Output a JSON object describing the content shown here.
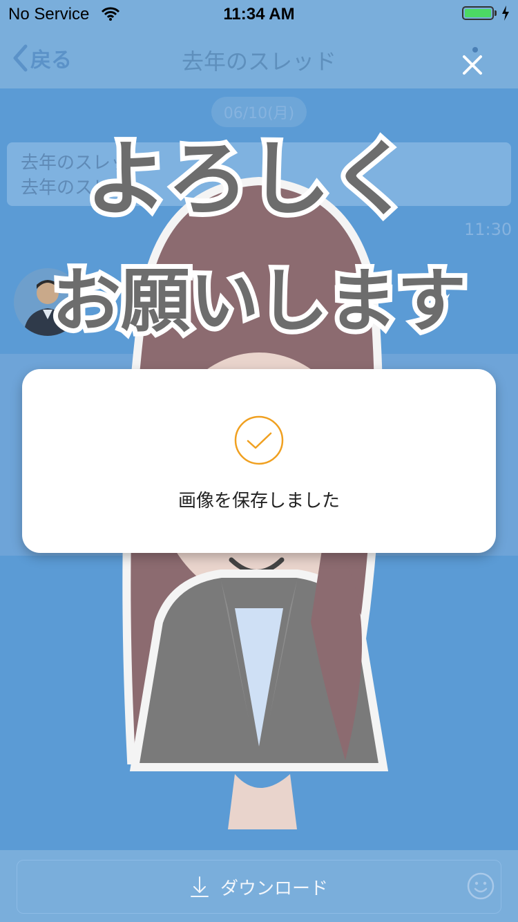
{
  "status_bar": {
    "carrier": "No Service",
    "time": "11:34 AM"
  },
  "nav": {
    "back_label": "戻る",
    "title": "去年のスレッド"
  },
  "chat": {
    "date_label": "06/10(月)",
    "message_lines": [
      "去年のスレッド",
      "去年のスレッ"
    ],
    "message_time": "11:30"
  },
  "sticker": {
    "text_line1": "よろしく",
    "text_line2": "お願いします"
  },
  "toast": {
    "message": "画像を保存しました",
    "accent_color": "#f0a020"
  },
  "bottom": {
    "download_label": "ダウンロード"
  }
}
